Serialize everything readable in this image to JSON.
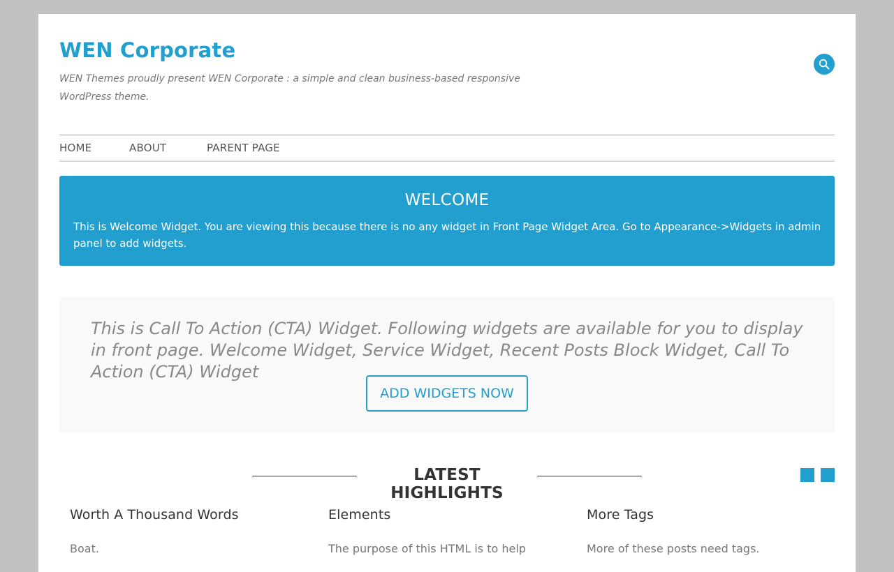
{
  "site": {
    "title": "WEN Corporate",
    "tagline": "WEN Themes proudly present WEN Corporate : a simple and clean business-based responsive WordPress theme."
  },
  "header": {
    "search_icon": "search-icon"
  },
  "nav": {
    "items": [
      {
        "label": "HOME"
      },
      {
        "label": "ABOUT"
      },
      {
        "label": "PARENT PAGE"
      }
    ]
  },
  "welcome": {
    "title": "WELCOME",
    "text": "This is Welcome Widget. You are viewing this because there is no any widget in Front Page Widget Area. Go to Appearance->Widgets in admin panel to add widgets."
  },
  "cta": {
    "text": "This is Call To Action (CTA) Widget. Following widgets are available for you to display in front page. Welcome Widget, Service Widget, Recent Posts Block Widget, Call To Action (CTA) Widget",
    "button_label": "ADD WIDGETS NOW"
  },
  "highlights": {
    "title": "LATEST HIGHLIGHTS",
    "posts": [
      {
        "title": "Worth A Thousand Words",
        "excerpt": "Boat."
      },
      {
        "title": "Elements",
        "excerpt": "The purpose of this HTML is to help"
      },
      {
        "title": "More Tags",
        "excerpt": "More of these posts need tags."
      }
    ]
  },
  "colors": {
    "accent": "#229fcf",
    "page_bg": "#c2c2c2",
    "cta_bg": "#f9f9f9"
  }
}
